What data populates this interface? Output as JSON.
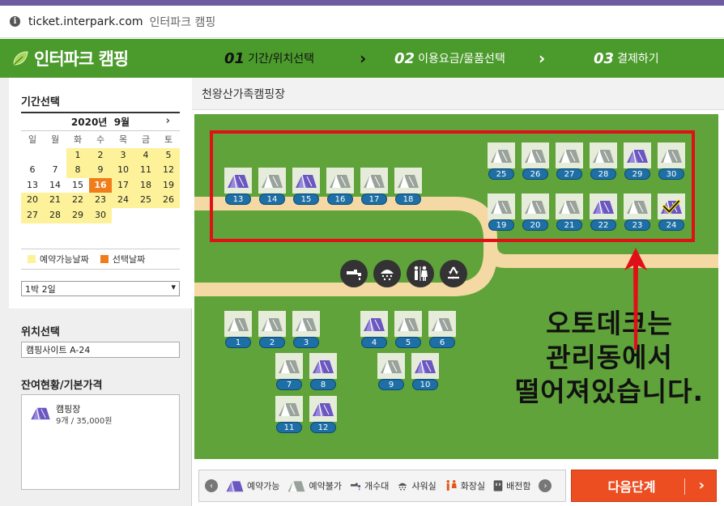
{
  "browser": {
    "url": "ticket.interpark.com",
    "title": "인터파크 캠핑"
  },
  "header": {
    "logo": "인터파크 캠핑",
    "steps": [
      {
        "num": "01",
        "label": "기간/위치선택",
        "active": true
      },
      {
        "num": "02",
        "label": "이용요금/물품선택",
        "active": false
      },
      {
        "num": "03",
        "label": "결제하기",
        "active": false
      }
    ]
  },
  "sidebar": {
    "period_title": "기간선택",
    "calendar": {
      "month_label": "2020년  9월",
      "next_icon": "chevron-right-icon",
      "dows": [
        "일",
        "월",
        "화",
        "수",
        "목",
        "금",
        "토"
      ],
      "weeks": [
        [
          "",
          "",
          "1",
          "2",
          "3",
          "4",
          "5"
        ],
        [
          "6",
          "7",
          "8",
          "9",
          "10",
          "11",
          "12"
        ],
        [
          "13",
          "14",
          "15",
          "16",
          "17",
          "18",
          "19"
        ],
        [
          "20",
          "21",
          "22",
          "23",
          "24",
          "25",
          "26"
        ],
        [
          "27",
          "28",
          "29",
          "30",
          "",
          "",
          ""
        ]
      ],
      "selected": "16",
      "available": [
        "1",
        "2",
        "3",
        "4",
        "5",
        "8",
        "9",
        "10",
        "11",
        "12",
        "16",
        "17",
        "18",
        "19",
        "20",
        "21",
        "22",
        "23",
        "24",
        "25",
        "26",
        "27",
        "28",
        "29",
        "30"
      ]
    },
    "legend": {
      "available_label": "예약가능날짜",
      "selected_label": "선택날짜",
      "available_color": "#fdf29a",
      "selected_color": "#f07d1a"
    },
    "nights_value": "1박 2일",
    "location_title": "위치선택",
    "site_value": "캠핑사이트 A-24",
    "stock_title": "잔여현황/기본가격",
    "stock": {
      "name": "캠핑장",
      "info": "9개 / 35,000원"
    }
  },
  "main": {
    "title": "천왕산가족캠핑장",
    "caption": [
      "오토데크는",
      "관리동에서",
      "떨어져있습니다."
    ],
    "sites": [
      {
        "n": "13",
        "status": "available"
      },
      {
        "n": "14",
        "status": "unavailable"
      },
      {
        "n": "15",
        "status": "available"
      },
      {
        "n": "16",
        "status": "unavailable"
      },
      {
        "n": "17",
        "status": "unavailable"
      },
      {
        "n": "18",
        "status": "unavailable"
      },
      {
        "n": "25",
        "status": "unavailable"
      },
      {
        "n": "26",
        "status": "unavailable"
      },
      {
        "n": "27",
        "status": "unavailable"
      },
      {
        "n": "28",
        "status": "unavailable"
      },
      {
        "n": "29",
        "status": "available"
      },
      {
        "n": "30",
        "status": "unavailable"
      },
      {
        "n": "19",
        "status": "unavailable"
      },
      {
        "n": "20",
        "status": "unavailable"
      },
      {
        "n": "21",
        "status": "unavailable"
      },
      {
        "n": "22",
        "status": "available"
      },
      {
        "n": "23",
        "status": "unavailable"
      },
      {
        "n": "24",
        "status": "selected"
      },
      {
        "n": "1",
        "status": "unavailable"
      },
      {
        "n": "2",
        "status": "unavailable"
      },
      {
        "n": "3",
        "status": "unavailable"
      },
      {
        "n": "7",
        "status": "unavailable"
      },
      {
        "n": "8",
        "status": "available"
      },
      {
        "n": "11",
        "status": "unavailable"
      },
      {
        "n": "12",
        "status": "available"
      },
      {
        "n": "4",
        "status": "available"
      },
      {
        "n": "5",
        "status": "unavailable"
      },
      {
        "n": "6",
        "status": "unavailable"
      },
      {
        "n": "9",
        "status": "unavailable"
      },
      {
        "n": "10",
        "status": "available"
      }
    ],
    "facilities": [
      "faucet-icon",
      "shower-icon",
      "restroom-icon",
      "recycle-icon"
    ]
  },
  "legend_bar": {
    "items": [
      {
        "icon": "tent-available-icon",
        "label": "예약가능"
      },
      {
        "icon": "tent-unavailable-icon",
        "label": "예약불가"
      },
      {
        "icon": "faucet-icon",
        "label": "개수대"
      },
      {
        "icon": "shower-icon",
        "label": "샤워실"
      },
      {
        "icon": "restroom-icon",
        "label": "화장실"
      },
      {
        "icon": "outlet-icon",
        "label": "배전함"
      }
    ]
  },
  "next_button": "다음단계",
  "colors": {
    "header_green": "#4b9a2c",
    "grass": "#5fa33a",
    "highlight_red": "#e01018",
    "next_orange": "#ec4e21",
    "site_number_blue": "#1e6fa5",
    "tent_available": "#6b57c0"
  }
}
